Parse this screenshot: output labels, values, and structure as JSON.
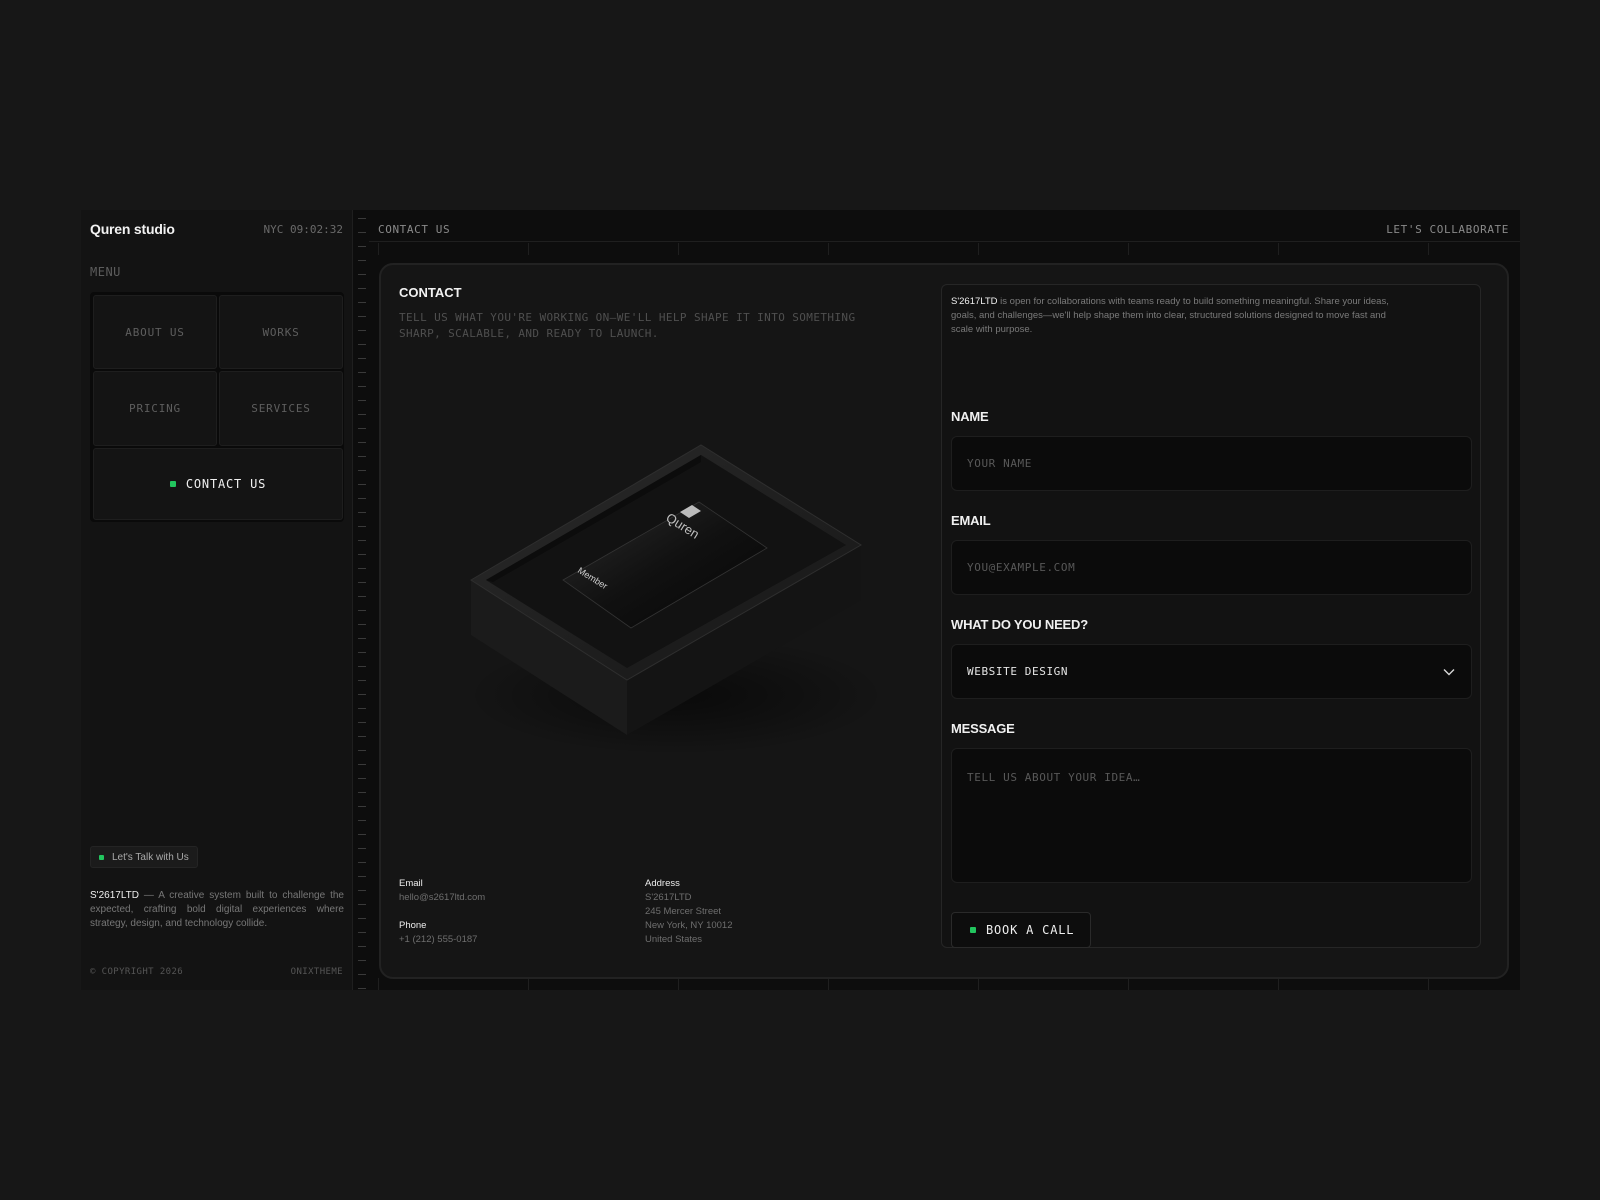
{
  "sidebar": {
    "brand": "Quren studio",
    "clock": "NYC 09:02:32",
    "menu_label": "MENU",
    "menu_items": [
      {
        "label": "ABOUT US"
      },
      {
        "label": "WORKS"
      },
      {
        "label": "PRICING"
      },
      {
        "label": "SERVICES"
      },
      {
        "label": "CONTACT US",
        "active": true
      }
    ],
    "talk_button": "Let's Talk with Us",
    "description_brand": "S'2617LTD",
    "description": " — A creative system built to challenge the expected, crafting bold digital experiences where strategy, design, and technology collide.",
    "copyright": "© COPYRIGHT 2026",
    "credit": "ONIXTHEME"
  },
  "header": {
    "breadcrumb": "CONTACT US",
    "right_link": "LET'S COLLABORATE"
  },
  "contact": {
    "title": "CONTACT",
    "subtitle": "TELL US WHAT YOU'RE WORKING ON—WE'LL HELP SHAPE IT INTO SOMETHING SHARP, SCALABLE, AND READY TO LAUNCH.",
    "card_brand": "Quren",
    "card_label": "Member",
    "email_label": "Email",
    "email": "hello@s2617ltd.com",
    "phone_label": "Phone",
    "phone": "+1 (212) 555-0187",
    "address_label": "Address",
    "address": [
      "S'2617LTD",
      "245 Mercer Street",
      "New York, NY 10012",
      "United States"
    ]
  },
  "form": {
    "intro_brand": "S'2617LTD",
    "intro": " is open for collaborations with teams ready to build something meaningful. Share your ideas, goals, and challenges—we'll help shape them into clear, structured solutions designed to move fast and scale with purpose.",
    "name_label": "NAME",
    "name_placeholder": "YOUR NAME",
    "email_label": "EMAIL",
    "email_placeholder": "YOU@EXAMPLE.COM",
    "need_label": "WHAT DO YOU NEED?",
    "need_value": "WEBSITE DESIGN",
    "message_label": "MESSAGE",
    "message_placeholder": "TELL US ABOUT YOUR IDEA…",
    "submit_label": "BOOK A CALL"
  },
  "colors": {
    "accent": "#22c55e",
    "background": "#171717",
    "panel": "#121212"
  },
  "icons": [
    "chevron-down-icon",
    "status-dot-icon"
  ]
}
